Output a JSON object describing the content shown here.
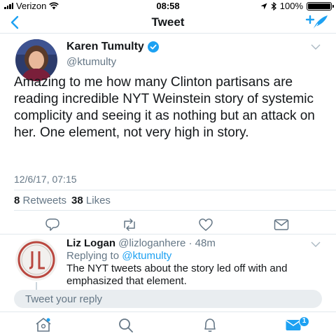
{
  "status_bar": {
    "carrier": "Verizon",
    "time": "08:58",
    "battery": "100%",
    "battery_level": 1.0
  },
  "nav": {
    "title": "Tweet",
    "back_icon": "chevron-left-icon",
    "compose_icon": "compose-tweet-icon"
  },
  "tweet": {
    "author_name": "Karen Tumulty",
    "handle": "@ktumulty",
    "verified": true,
    "text": "Amazing to me how many Clinton partisans are reading incredible NYT Weinstein story of systemic complicity and seeing it as nothing but an attack on her. One element, not very high in story.",
    "timestamp": "12/6/17, 07:15",
    "retweets_count": "8",
    "retweets_label": "Retweets",
    "likes_count": "38",
    "likes_label": "Likes"
  },
  "reply": {
    "author_name": "Liz Logan",
    "handle": "@lizloganhere",
    "separator": "·",
    "age": "48m",
    "replying_prefix": "Replying to",
    "replying_handle": "@ktumulty",
    "text": "The NYT tweets about the story led off with and emphasized that element."
  },
  "composer": {
    "placeholder": "Tweet your reply"
  },
  "tab_bar": {
    "icons": [
      "home-icon",
      "search-icon",
      "notifications-icon",
      "messages-icon"
    ],
    "messages_badge": "1"
  },
  "colors": {
    "accent": "#1da1f2",
    "text": "#14171a",
    "secondary": "#657786",
    "divider": "#e1e8ed"
  }
}
